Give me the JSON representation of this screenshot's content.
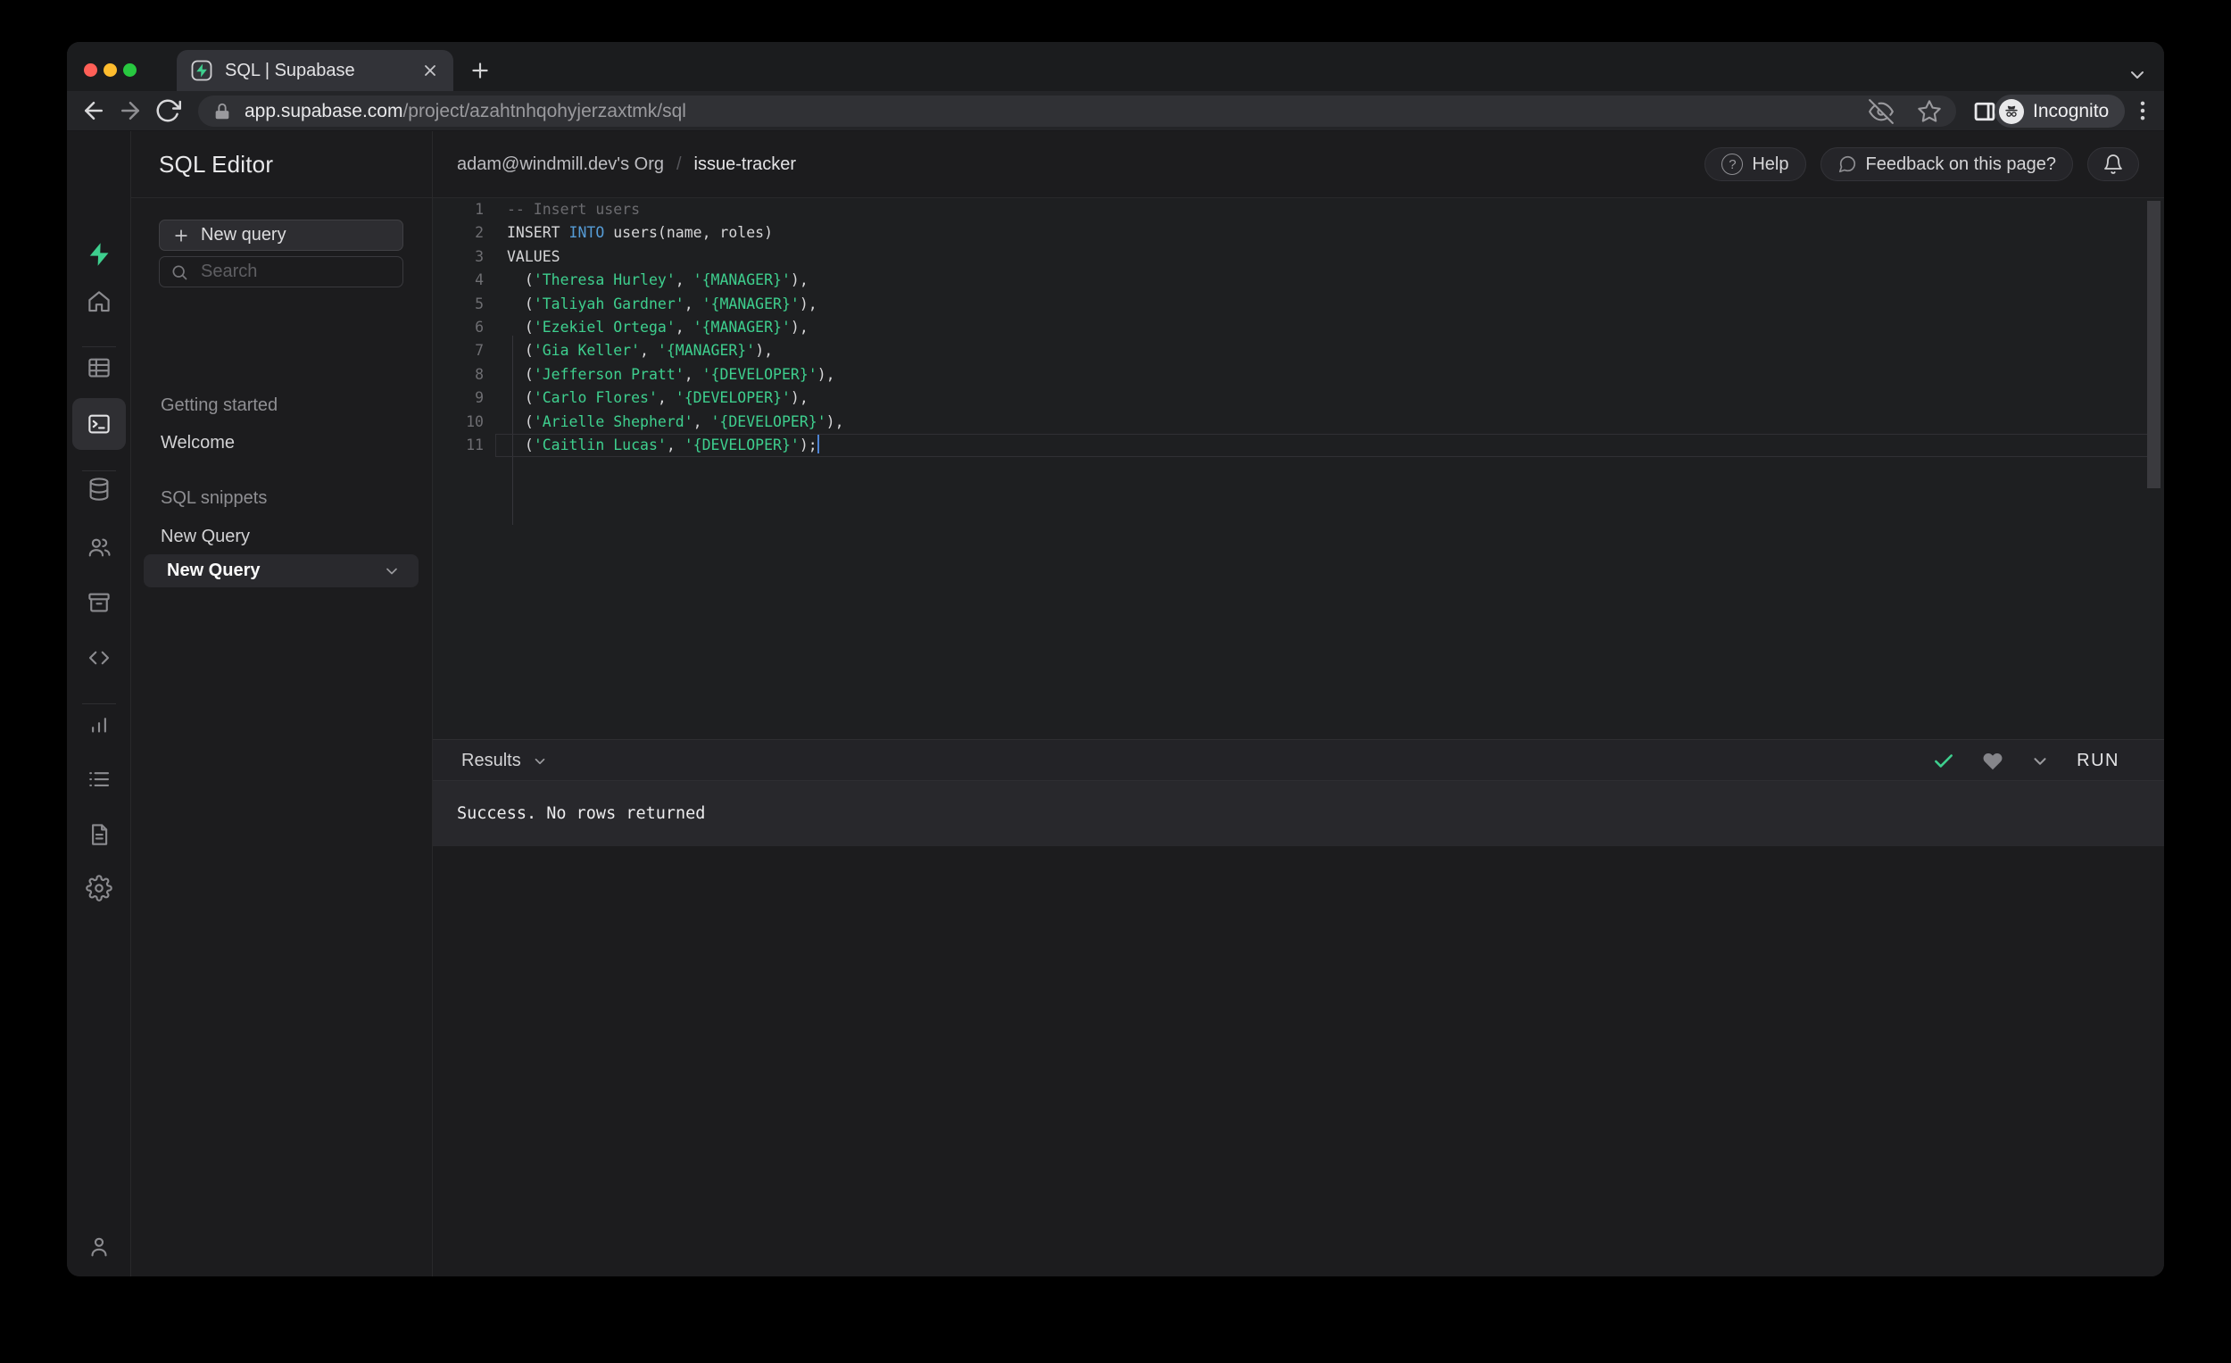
{
  "browser": {
    "tab_title": "SQL | Supabase",
    "url": {
      "domain": "app.supabase.com",
      "path": "/project/azahtnhqohyjerzaxtmk/sql"
    },
    "incognito_label": "Incognito",
    "icons": [
      "supabase-favicon",
      "close-icon",
      "new-tab-plus-icon",
      "tab-search-chevron-icon",
      "back-icon",
      "forward-icon",
      "reload-icon",
      "lock-icon",
      "eye-off-icon",
      "star-icon",
      "side-panel-icon",
      "incognito-icon",
      "menu-dots-icon"
    ],
    "traffic_light_colors": {
      "close": "#ff5f57",
      "minimize": "#febc2e",
      "zoom": "#28c840"
    }
  },
  "app_header": {
    "title": "SQL Editor",
    "breadcrumb": {
      "org": "adam@windmill.dev's Org",
      "separator": "/",
      "project": "issue-tracker"
    },
    "help_label": "Help",
    "feedback_label": "Feedback on this page?",
    "icons": [
      "help-circle-icon",
      "chat-bubble-icon",
      "bell-icon"
    ]
  },
  "rail": {
    "items": [
      {
        "name": "home",
        "active": false
      },
      {
        "name": "table-editor",
        "active": false
      },
      {
        "name": "sql-editor",
        "active": true
      },
      {
        "name": "database",
        "active": false
      },
      {
        "name": "auth",
        "active": false
      },
      {
        "name": "storage",
        "active": false
      },
      {
        "name": "edge-functions",
        "active": false
      },
      {
        "name": "reports",
        "active": false
      },
      {
        "name": "logs",
        "active": false
      },
      {
        "name": "api-docs",
        "active": false
      },
      {
        "name": "settings",
        "active": false
      }
    ],
    "footer_item": {
      "name": "account"
    },
    "logo": "supabase-logo",
    "brand_color": "#3ecf8e"
  },
  "panel": {
    "new_query_button": "New query",
    "search_placeholder": "Search",
    "sections": [
      {
        "label": "Getting started",
        "items": [
          {
            "label": "Welcome"
          }
        ]
      },
      {
        "label": "SQL snippets",
        "items": [
          {
            "label": "New Query"
          }
        ]
      }
    ],
    "active_snippet": {
      "label": "New Query"
    }
  },
  "editor": {
    "active_line": 11,
    "colors": {
      "plain": "#d6d6d8",
      "comment": "#6b6b6f",
      "keyword": "#569cd6",
      "string": "#3ecf8e",
      "cursor": "#4e83d4"
    },
    "lines": [
      {
        "n": 1,
        "parts": [
          {
            "c": "comment",
            "t": "-- Insert users"
          }
        ]
      },
      {
        "n": 2,
        "parts": [
          {
            "c": "plain",
            "t": "INSERT "
          },
          {
            "c": "keyword",
            "t": "INTO"
          },
          {
            "c": "plain",
            "t": " users(name, roles)"
          }
        ]
      },
      {
        "n": 3,
        "parts": [
          {
            "c": "plain",
            "t": "VALUES"
          }
        ]
      },
      {
        "n": 4,
        "parts": [
          {
            "c": "plain",
            "t": "  ("
          },
          {
            "c": "string",
            "t": "'Theresa Hurley'"
          },
          {
            "c": "plain",
            "t": ", "
          },
          {
            "c": "string",
            "t": "'{MANAGER}'"
          },
          {
            "c": "plain",
            "t": "),"
          }
        ]
      },
      {
        "n": 5,
        "parts": [
          {
            "c": "plain",
            "t": "  ("
          },
          {
            "c": "string",
            "t": "'Taliyah Gardner'"
          },
          {
            "c": "plain",
            "t": ", "
          },
          {
            "c": "string",
            "t": "'{MANAGER}'"
          },
          {
            "c": "plain",
            "t": "),"
          }
        ]
      },
      {
        "n": 6,
        "parts": [
          {
            "c": "plain",
            "t": "  ("
          },
          {
            "c": "string",
            "t": "'Ezekiel Ortega'"
          },
          {
            "c": "plain",
            "t": ", "
          },
          {
            "c": "string",
            "t": "'{MANAGER}'"
          },
          {
            "c": "plain",
            "t": "),"
          }
        ]
      },
      {
        "n": 7,
        "parts": [
          {
            "c": "plain",
            "t": "  ("
          },
          {
            "c": "string",
            "t": "'Gia Keller'"
          },
          {
            "c": "plain",
            "t": ", "
          },
          {
            "c": "string",
            "t": "'{MANAGER}'"
          },
          {
            "c": "plain",
            "t": "),"
          }
        ]
      },
      {
        "n": 8,
        "parts": [
          {
            "c": "plain",
            "t": "  ("
          },
          {
            "c": "string",
            "t": "'Jefferson Pratt'"
          },
          {
            "c": "plain",
            "t": ", "
          },
          {
            "c": "string",
            "t": "'{DEVELOPER}'"
          },
          {
            "c": "plain",
            "t": "),"
          }
        ]
      },
      {
        "n": 9,
        "parts": [
          {
            "c": "plain",
            "t": "  ("
          },
          {
            "c": "string",
            "t": "'Carlo Flores'"
          },
          {
            "c": "plain",
            "t": ", "
          },
          {
            "c": "string",
            "t": "'{DEVELOPER}'"
          },
          {
            "c": "plain",
            "t": "),"
          }
        ]
      },
      {
        "n": 10,
        "parts": [
          {
            "c": "plain",
            "t": "  ("
          },
          {
            "c": "string",
            "t": "'Arielle Shepherd'"
          },
          {
            "c": "plain",
            "t": ", "
          },
          {
            "c": "string",
            "t": "'{DEVELOPER}'"
          },
          {
            "c": "plain",
            "t": "),"
          }
        ]
      },
      {
        "n": 11,
        "cursor": true,
        "parts": [
          {
            "c": "plain",
            "t": "  ("
          },
          {
            "c": "string",
            "t": "'Caitlin Lucas'"
          },
          {
            "c": "plain",
            "t": ", "
          },
          {
            "c": "string",
            "t": "'{DEVELOPER}'"
          },
          {
            "c": "plain",
            "t": ");"
          }
        ]
      }
    ]
  },
  "results": {
    "label": "Results",
    "run_button": "RUN",
    "message": "Success. No rows returned",
    "status_color": "#3ecf8e",
    "icons": [
      "success-check-icon",
      "favorite-heart-icon",
      "chevron-down-icon"
    ]
  }
}
